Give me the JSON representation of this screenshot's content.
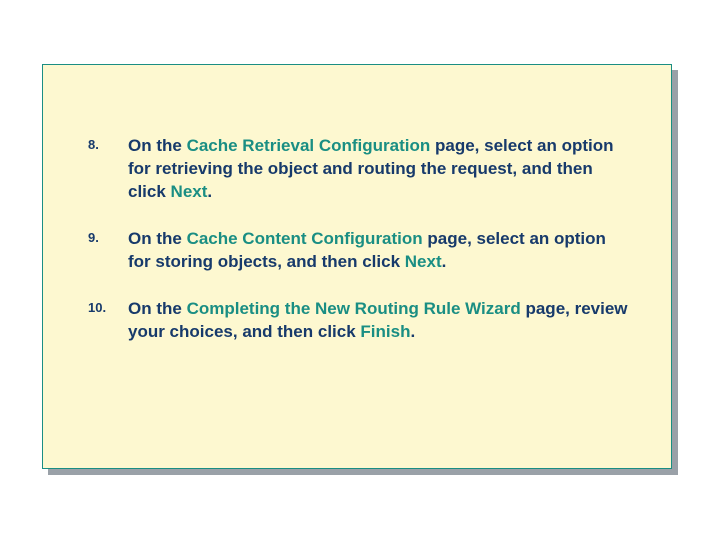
{
  "items": [
    {
      "num": "8.",
      "t0": "On the ",
      "h0": "Cache Retrieval Configuration",
      "t1": " page, select an option for retrieving the object and routing the request, and then click ",
      "h1": "Next",
      "t2": "."
    },
    {
      "num": "9.",
      "t0": "On the ",
      "h0": "Cache Content Configuration",
      "t1": " page, select an option for storing objects, and then click ",
      "h1": "Next",
      "t2": "."
    },
    {
      "num": "10.",
      "t0": "On the ",
      "h0": "Completing the New Routing Rule Wizard",
      "t1": " page, review your choices, and then click ",
      "h1": "Finish",
      "t2": "."
    }
  ]
}
